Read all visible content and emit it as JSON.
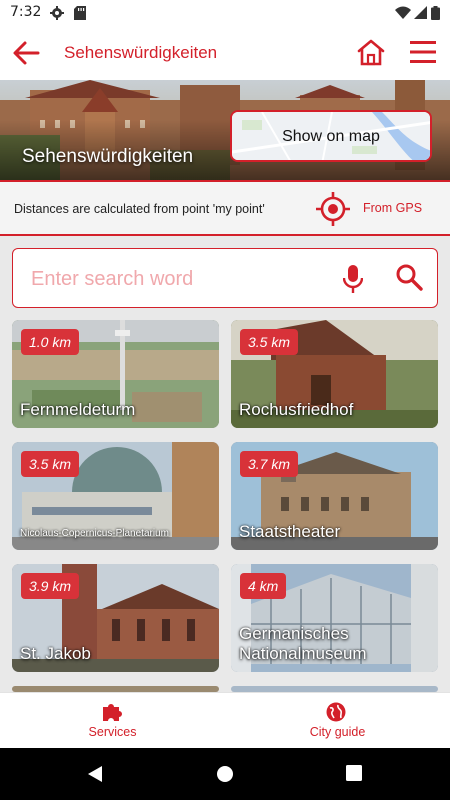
{
  "status_bar": {
    "time": "7:32"
  },
  "app_bar": {
    "title": "Sehenswürdigkeiten"
  },
  "hero": {
    "title": "Sehenswürdigkeiten",
    "map_button_label": "Show on map"
  },
  "info": {
    "text": "Distances are calculated from point 'my point'",
    "gps_label": "From GPS"
  },
  "search": {
    "placeholder": "Enter search word"
  },
  "sights": [
    {
      "name": "Fernmeldeturm",
      "distance": "1.0 km"
    },
    {
      "name": "Rochusfriedhof",
      "distance": "3.5 km"
    },
    {
      "name": "Nicolaus-Copernicus-Planetarium",
      "distance": "3.5 km"
    },
    {
      "name": "Staatstheater",
      "distance": "3.7 km"
    },
    {
      "name": "St. Jakob",
      "distance": "3.9 km"
    },
    {
      "name": "Germanisches Nationalmuseum",
      "distance": "4 km"
    }
  ],
  "bottom_nav": {
    "services_label": "Services",
    "city_guide_label": "City guide"
  },
  "colors": {
    "accent": "#d3202a",
    "badge": "#d83239",
    "background": "#e9e9e9"
  }
}
